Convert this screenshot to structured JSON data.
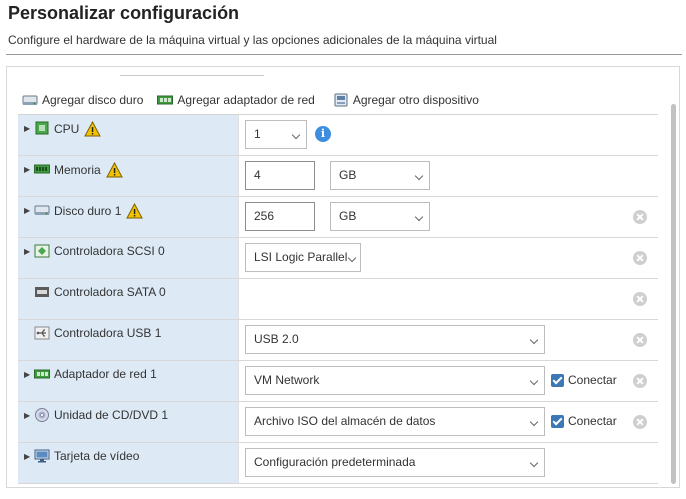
{
  "header": {
    "title": "Personalizar configuración",
    "subtitle": "Configure el hardware de la máquina virtual y las opciones adicionales de la máquina virtual"
  },
  "toolbar": {
    "add_disk": "Agregar disco duro",
    "add_nic": "Agregar adaptador de red",
    "add_other": "Agregar otro dispositivo"
  },
  "rows": {
    "cpu": {
      "label": "CPU",
      "value": "1"
    },
    "memory": {
      "label": "Memoria",
      "value": "4",
      "unit": "GB"
    },
    "disk": {
      "label": "Disco duro 1",
      "value": "256",
      "unit": "GB"
    },
    "scsi": {
      "label": "Controladora SCSI 0",
      "value": "LSI Logic Parallel"
    },
    "sata": {
      "label": "Controladora SATA 0"
    },
    "usb": {
      "label": "Controladora USB 1",
      "value": "USB 2.0"
    },
    "nic": {
      "label": "Adaptador de red 1",
      "value": "VM Network",
      "connect": "Conectar"
    },
    "cdrom": {
      "label": "Unidad de CD/DVD 1",
      "value": "Archivo ISO del almacén de datos",
      "connect": "Conectar"
    },
    "video": {
      "label": "Tarjeta de vídeo",
      "value": "Configuración predeterminada"
    }
  },
  "colors": {
    "label_cell_bg": "#ddeaf6",
    "checkbox": "#3c78b5",
    "warning": "#f2c200",
    "info": "#3d8ee0"
  },
  "icons": {
    "info": "i"
  }
}
